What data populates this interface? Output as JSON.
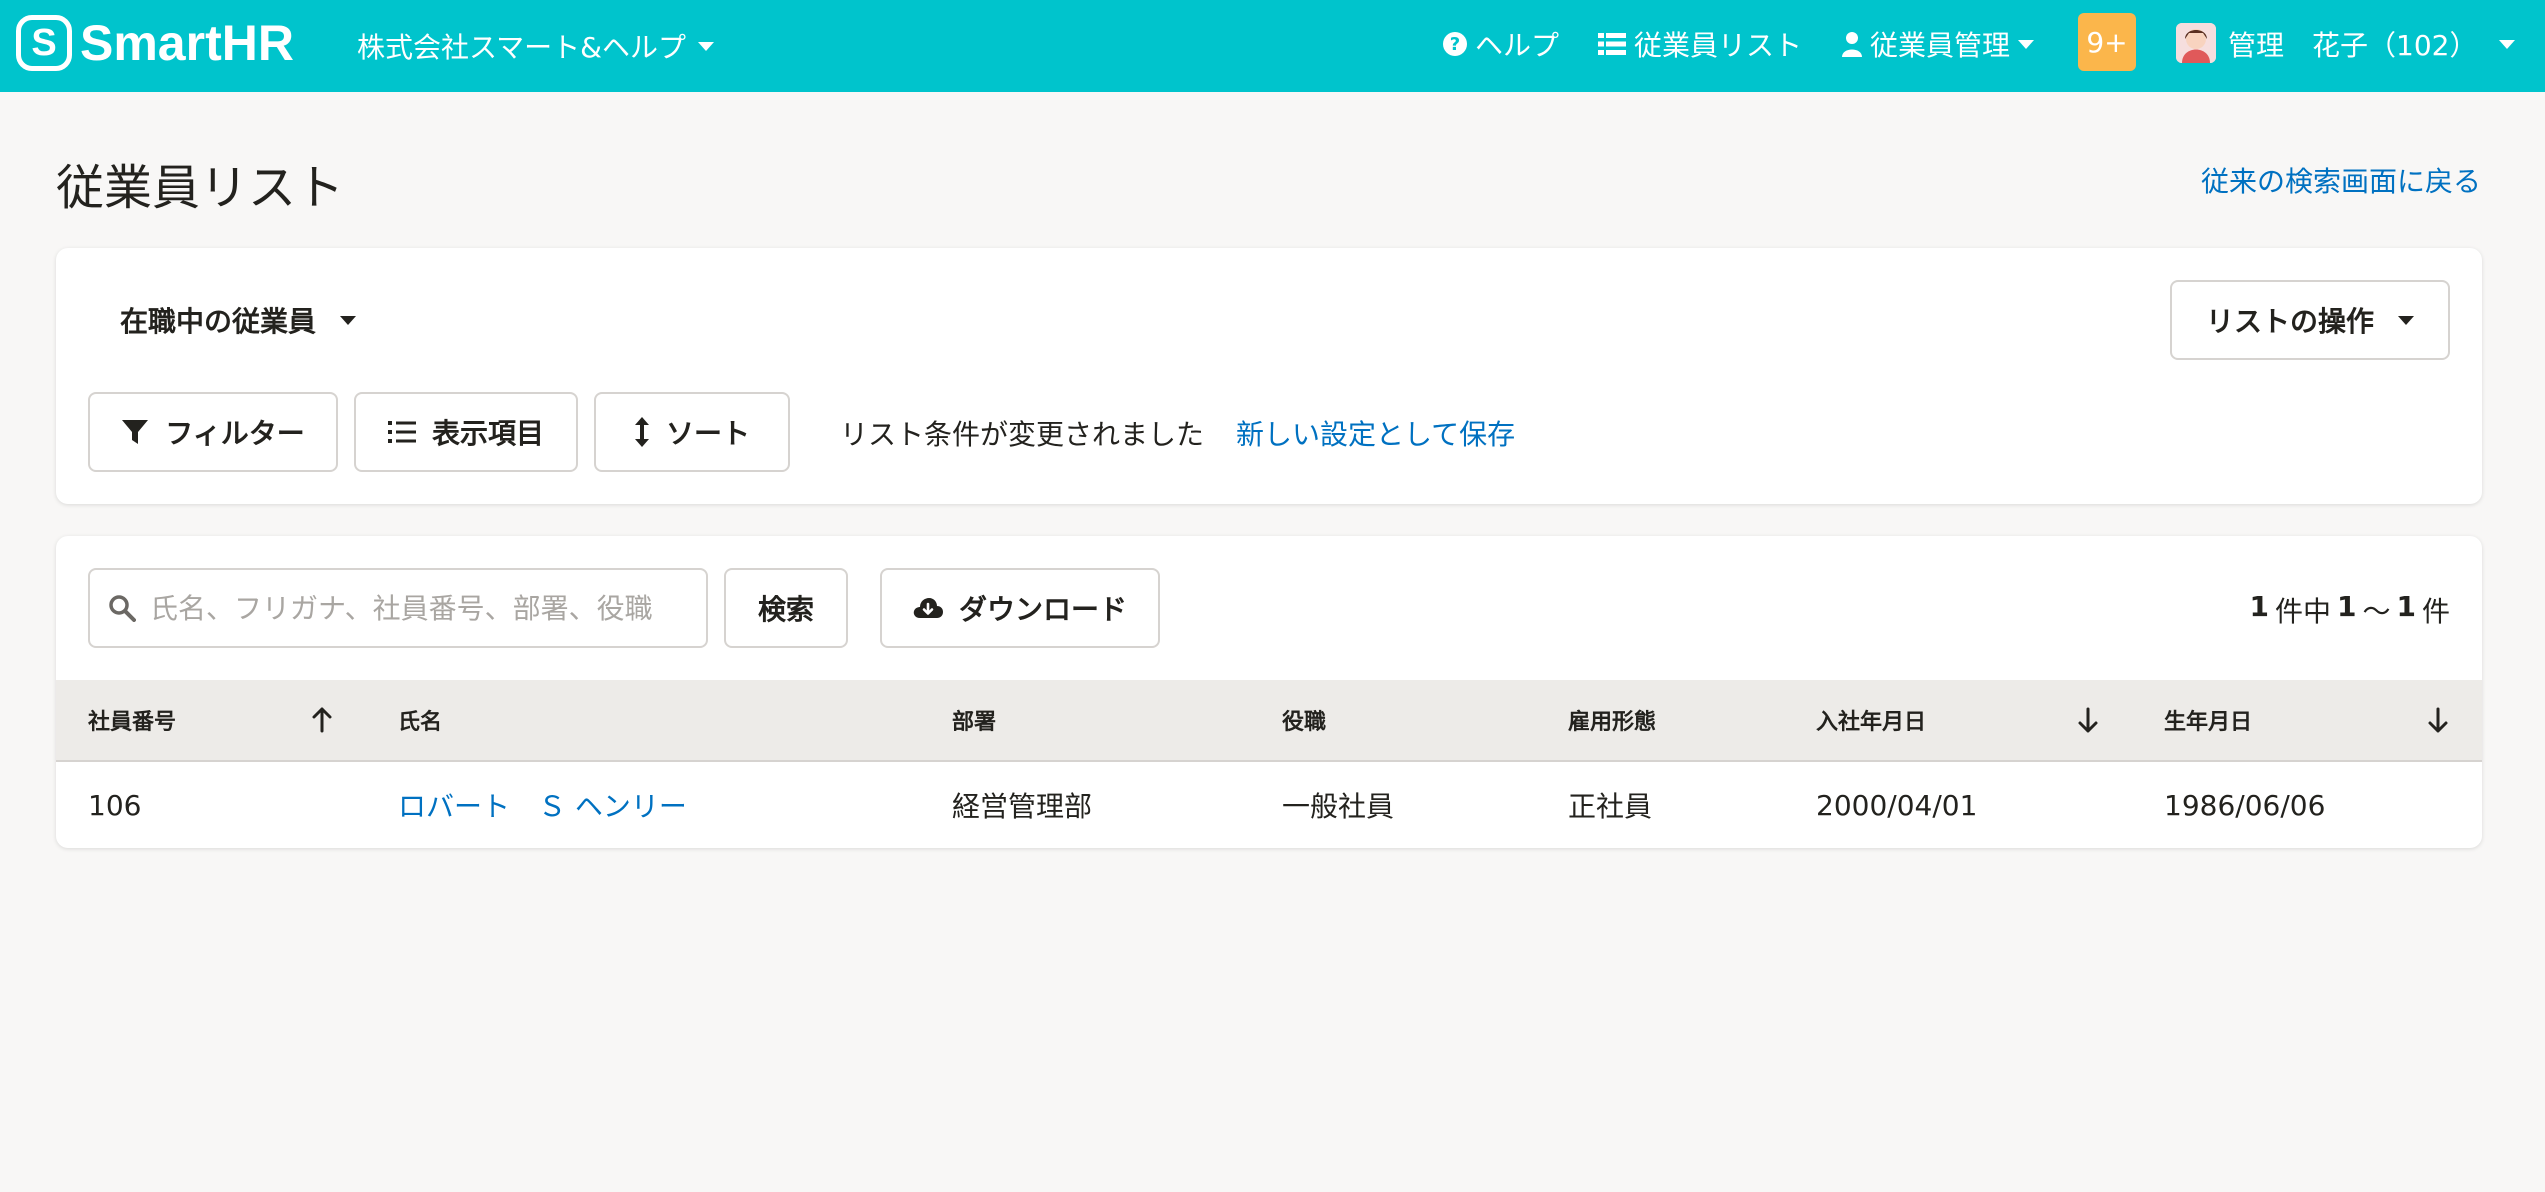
{
  "header": {
    "logo_text": "SmartHR",
    "logo_mark": "S",
    "company": "株式会社スマート&ヘルプ",
    "nav": {
      "help": "ヘルプ",
      "employee_list": "従業員リスト",
      "employee_mgmt": "従業員管理"
    },
    "notification_badge": "9+",
    "user_label": "管理　花子（102）",
    "colors": {
      "brand": "#00c4cc",
      "badge": "#fbb64b"
    }
  },
  "page": {
    "title": "従業員リスト",
    "back_link": "従来の検索画面に戻る"
  },
  "list_controls": {
    "status_select": "在職中の従業員",
    "list_ops": "リストの操作",
    "filter_button": "フィルター",
    "columns_button": "表示項目",
    "sort_button": "ソート",
    "changed_message": "リスト条件が変更されました",
    "save_link": "新しい設定として保存"
  },
  "search": {
    "placeholder": "氏名、フリガナ、社員番号、部署、役職",
    "value": "",
    "search_button": "検索",
    "download_button": "ダウンロード"
  },
  "result": {
    "total": "1",
    "unit_a": "件中",
    "from": "1",
    "sep": "～",
    "to": "1",
    "unit_b": "件"
  },
  "table": {
    "columns": [
      "社員番号",
      "氏名",
      "部署",
      "役職",
      "雇用形態",
      "入社年月日",
      "生年月日"
    ],
    "rows": [
      {
        "employee_no": "106",
        "name": "ロバート　Ｓ ヘンリー",
        "department": "経営管理部",
        "position": "一般社員",
        "employment_type": "正社員",
        "join_date": "2000/04/01",
        "birth_date": "1986/06/06"
      }
    ]
  },
  "icons": {
    "help": "question-circle-icon",
    "list": "list-icon",
    "person": "person-icon",
    "filter": "filter-icon",
    "columns": "list-bullets-icon",
    "sort": "sort-vertical-icon",
    "search": "search-icon",
    "download": "cloud-download-icon",
    "sort_asc": "arrow-up-icon",
    "sort_desc": "arrow-down-icon"
  },
  "link_color": "#0071c1"
}
